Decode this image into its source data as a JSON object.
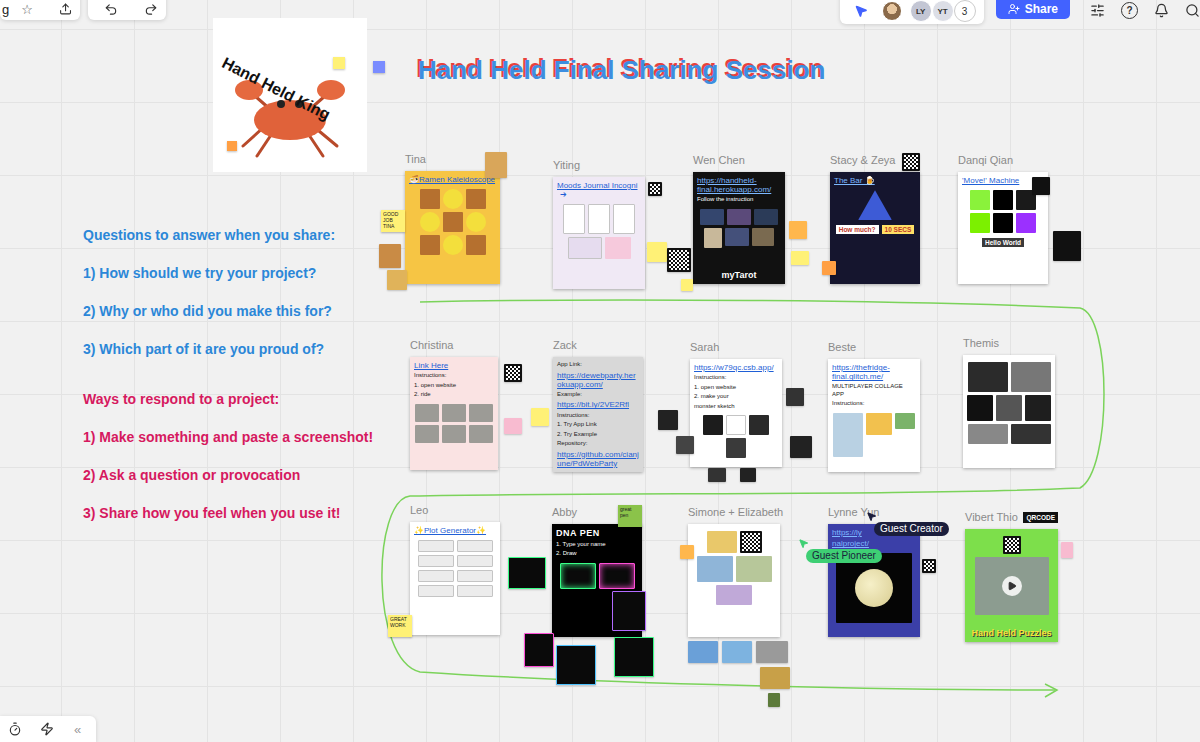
{
  "toolbar": {
    "board_name": "g",
    "star": "☆"
  },
  "presence": {
    "avatars": [
      {
        "initials": "LY",
        "color": "#c3c6d4"
      },
      {
        "initials": "YT",
        "color": "#dcdee6"
      }
    ],
    "count": "3"
  },
  "share_button": "Share",
  "help": "?",
  "bottom_bar": {
    "collapse": "«"
  },
  "board": {
    "title": "Hand Held Final Sharing Session",
    "logo": {
      "caption": "Hand Held King"
    },
    "prompts": {
      "questions_title": "Questions to answer when you share:",
      "questions": [
        "1) How should we try your project?",
        "2) Why or who did you make this for?",
        "3) Which part of it are you proud of?"
      ],
      "responses_title": "Ways to respond to a project:",
      "responses": [
        "1) Make something and paste a screenshot!",
        "2) Ask a question or provocation",
        "3) Share how you feel when you use it!"
      ]
    },
    "projects": [
      {
        "author": "Tina",
        "color": "#f6c544",
        "content": [
          {
            "text": "🍜Ramen Kaleidoscope",
            "kind": "link"
          }
        ],
        "tags": [],
        "notes": [
          {
            "text": "GOOD JOB TINA",
            "color": "#fff176"
          }
        ]
      },
      {
        "author": "Yiting",
        "color": "#f0e9f5",
        "content": [
          {
            "text": "Moods Journal Incogni",
            "kind": "link",
            "trail": "➔"
          }
        ],
        "tags": [],
        "notes": []
      },
      {
        "author": "Wen Chen",
        "color": "#111111",
        "content": [
          {
            "text": "https://handheld-final.herokuapp.com/",
            "kind": "link"
          },
          {
            "text": "Follow the instruction",
            "kind": "text"
          }
        ],
        "tags": [],
        "footer": "myTarot",
        "notes": []
      },
      {
        "author": "Stacy & Zeya",
        "color": "#15152e",
        "content": [
          {
            "text": "The Bar 🍺",
            "kind": "link"
          }
        ],
        "tags": [
          {
            "text": "How much?",
            "color": "#ffffff"
          },
          {
            "text": "10 SECS",
            "color": "#ffe066"
          }
        ],
        "notes": []
      },
      {
        "author": "Danqi Qian",
        "color": "#ffffff",
        "content": [
          {
            "text": "'Move!' Machine",
            "kind": "link"
          }
        ],
        "tags": [
          {
            "text": "Hello World",
            "color": "#3a3a3a"
          }
        ],
        "notes": []
      },
      {
        "author": "Christina",
        "color": "#fae3e3",
        "content": [
          {
            "text": "Link Here",
            "kind": "link"
          },
          {
            "text": "Instructions:",
            "kind": "text"
          },
          {
            "text": "1. open website",
            "kind": "text"
          },
          {
            "text": "2. ride",
            "kind": "text"
          }
        ],
        "tags": [],
        "notes": []
      },
      {
        "author": "Zack",
        "color": "#d8d8d8",
        "content": [
          {
            "text": "App Link:",
            "kind": "text"
          },
          {
            "text": "https://dewebparty.herokuapp.com/",
            "kind": "link"
          },
          {
            "text": "Example:",
            "kind": "text"
          },
          {
            "text": "https://bit.ly/2VE2Rfl",
            "kind": "link"
          },
          {
            "text": "Instructions:",
            "kind": "text"
          },
          {
            "text": "1. Try App Link",
            "kind": "text"
          },
          {
            "text": "2. Try Example",
            "kind": "text"
          },
          {
            "text": "Repository:",
            "kind": "text"
          },
          {
            "text": "https://github.com/cianjune/PdWebParty",
            "kind": "link"
          }
        ],
        "tags": [],
        "notes": []
      },
      {
        "author": "Sarah",
        "color": "#ffffff",
        "content": [
          {
            "text": "https://w79qc.csb.app/",
            "kind": "link"
          },
          {
            "text": "Instructions:",
            "kind": "text"
          },
          {
            "text": "1. open website",
            "kind": "text"
          },
          {
            "text": "2. make your",
            "kind": "text"
          },
          {
            "text": "monster sketch",
            "kind": "text"
          }
        ],
        "tags": [],
        "notes": []
      },
      {
        "author": "Beste",
        "color": "#ffffff",
        "content": [
          {
            "text": "https://thefridge-final.glitch.me/",
            "kind": "link"
          },
          {
            "text": "MULTIPLAYER COLLAGE APP",
            "kind": "text"
          },
          {
            "text": "Instructions:",
            "kind": "text"
          }
        ],
        "tags": [],
        "notes": []
      },
      {
        "author": "Themis",
        "color": "#ffffff",
        "content": [],
        "tags": [],
        "notes": []
      },
      {
        "author": "Leo",
        "color": "#ffffff",
        "content": [
          {
            "text": "✨Plot Generator✨",
            "kind": "link"
          }
        ],
        "tags": [],
        "notes": [
          {
            "text": "GREAT WORK",
            "color": "#fff176"
          }
        ]
      },
      {
        "author": "Abby",
        "color": "#000000",
        "content": [
          {
            "text": "DNA PEN",
            "kind": "heading"
          },
          {
            "text": "1. Type your name",
            "kind": "text"
          },
          {
            "text": "2. Draw",
            "kind": "text"
          }
        ],
        "tags": [],
        "notes": [
          {
            "text": "great pen",
            "color": "#8bc34a"
          }
        ]
      },
      {
        "author": "Simone + Elizabeth",
        "color": "#ffffff",
        "content": [],
        "tags": [],
        "notes": []
      },
      {
        "author": "Lynne Yun",
        "color": "#3b3fa8",
        "content": [
          {
            "text": "https://ly",
            "kind": "link"
          },
          {
            "text": "nalproject/",
            "kind": "link"
          }
        ],
        "tags": [],
        "notes": []
      },
      {
        "author": "Vibert Thio",
        "color": "#7ddf4b",
        "content": [],
        "tags": [],
        "footer": "Hand Held Puzzles",
        "badge": "QRCODE",
        "notes": []
      }
    ]
  },
  "cursors": [
    {
      "label": "Guest Creator",
      "color": "#1b1e3c"
    },
    {
      "label": "Guest Pioneer",
      "color": "#3ecf74"
    }
  ]
}
